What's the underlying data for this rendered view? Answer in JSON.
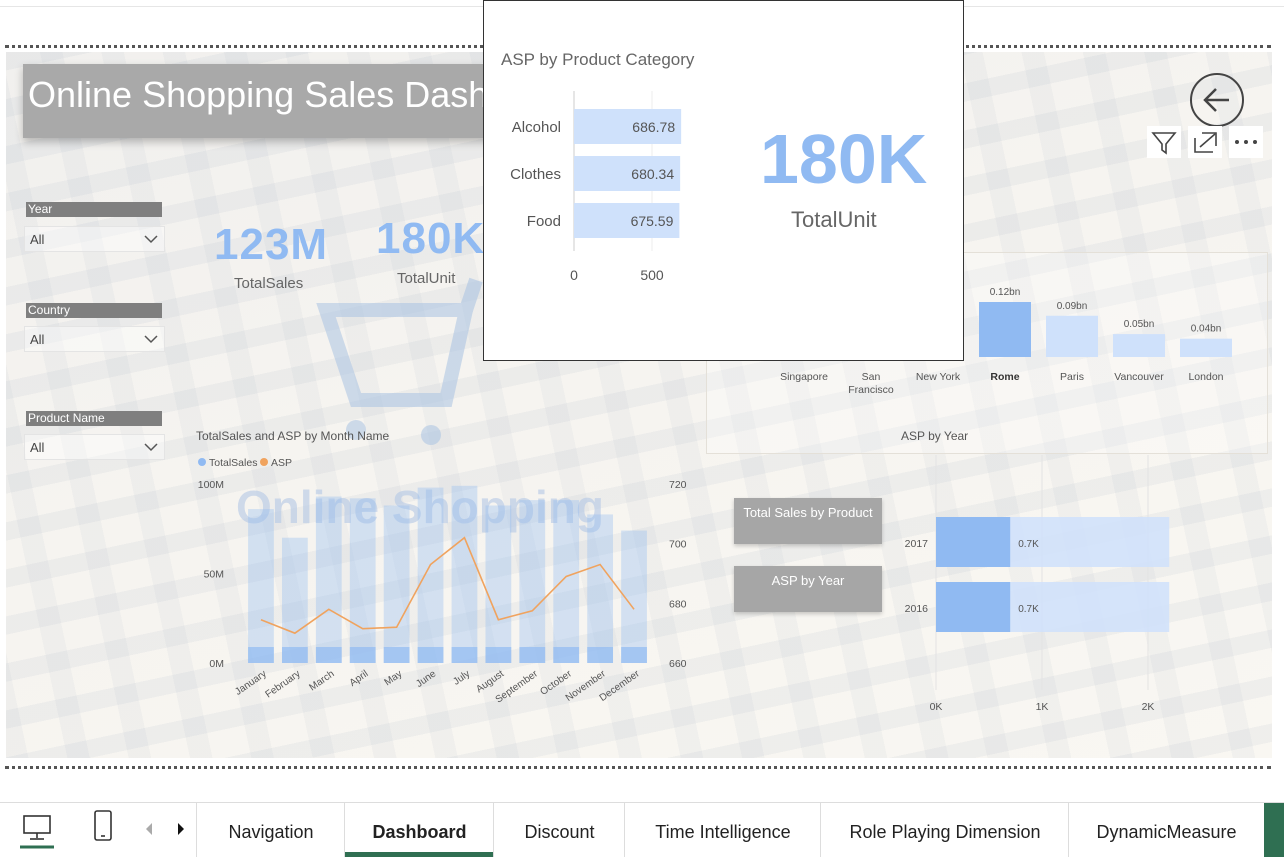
{
  "header": {
    "title": "Online Shopping Sales Dashboard"
  },
  "slicers": [
    {
      "label": "Year",
      "value": "All"
    },
    {
      "label": "Country",
      "value": "All"
    },
    {
      "label": "Product Name",
      "value": "All"
    }
  ],
  "kpis": {
    "sales_value": "123M",
    "sales_label": "TotalSales",
    "units_value": "180K",
    "units_label": "TotalUnit"
  },
  "visual_header": {
    "filter_icon": "filter-icon",
    "focus_icon": "focus-mode-icon",
    "more_icon": "more-options-icon"
  },
  "buttons": {
    "total_sales_by_product": "Total Sales by Product",
    "asp_by_year": "ASP by Year"
  },
  "watermark": "Online Shopping",
  "popup": {
    "title": "ASP by Product Category",
    "kpi_value": "180K",
    "kpi_label": "TotalUnit"
  },
  "chart_data": [
    {
      "type": "bar",
      "title": "ASP by Product Category",
      "orientation": "horizontal",
      "categories": [
        "Alcohol",
        "Clothes",
        "Food"
      ],
      "values": [
        686.78,
        680.34,
        675.59
      ],
      "data_labels": [
        "686.78",
        "680.34",
        "675.59"
      ],
      "x_ticks": [
        "0",
        "500"
      ],
      "xlim": [
        0,
        700
      ]
    },
    {
      "type": "bar",
      "title": "",
      "categories": [
        "Singapore",
        "San Francisco",
        "New York",
        "Rome",
        "Paris",
        "Vancouver",
        "London"
      ],
      "visible_values": {
        "Rome": 0.12,
        "Paris": 0.09,
        "Vancouver": 0.05,
        "London": 0.04
      },
      "data_labels": [
        "",
        "",
        "",
        "0.12bn",
        "0.09bn",
        "0.05bn",
        "0.04bn"
      ],
      "unit": "bn",
      "highlighted": "Rome"
    },
    {
      "type": "bar+line",
      "title": "TotalSales and ASP by Month Name",
      "legend": [
        "TotalSales",
        "ASP"
      ],
      "legend_position": "top-left",
      "categories": [
        "January",
        "February",
        "March",
        "April",
        "May",
        "June",
        "July",
        "August",
        "September",
        "October",
        "November",
        "December"
      ],
      "series": [
        {
          "name": "TotalSales",
          "axis": "left",
          "values": [
            86,
            70,
            93,
            92,
            88,
            98,
            99,
            88,
            91,
            91,
            83,
            74
          ]
        },
        {
          "name": "ASP",
          "axis": "right",
          "values": [
            674.5,
            670,
            678,
            671.5,
            672,
            693,
            702,
            674.5,
            677.5,
            689,
            693,
            678
          ]
        }
      ],
      "y_left_ticks": [
        "0M",
        "50M",
        "100M"
      ],
      "y_left_lim": [
        0,
        100
      ],
      "y_right_ticks": [
        "660",
        "680",
        "700",
        "720"
      ],
      "y_right_lim": [
        660,
        720
      ],
      "colors": {
        "TotalSales": "#9cc3f5",
        "ASP": "#f0a35e"
      }
    },
    {
      "type": "bar",
      "title": "ASP by Year",
      "orientation": "horizontal",
      "categories": [
        "2017",
        "2016"
      ],
      "values": [
        0.7,
        0.7
      ],
      "background_values": [
        2.2,
        2.2
      ],
      "data_labels": [
        "0.7K",
        "0.7K"
      ],
      "x_ticks": [
        "0K",
        "1K",
        "2K"
      ],
      "xlim": [
        0,
        2.2
      ],
      "unit": "K"
    }
  ],
  "tabs": [
    {
      "label": "Navigation"
    },
    {
      "label": "Dashboard",
      "active": true
    },
    {
      "label": "Discount"
    },
    {
      "label": "Time Intelligence"
    },
    {
      "label": "Role Playing Dimension"
    },
    {
      "label": "DynamicMeasure"
    }
  ],
  "colors": {
    "accent": "#2f6f52",
    "bar": "#90baf2",
    "bar_light": "#cfe1fb",
    "line": "#f0a35e",
    "title_bg": "#a9a9a9"
  }
}
